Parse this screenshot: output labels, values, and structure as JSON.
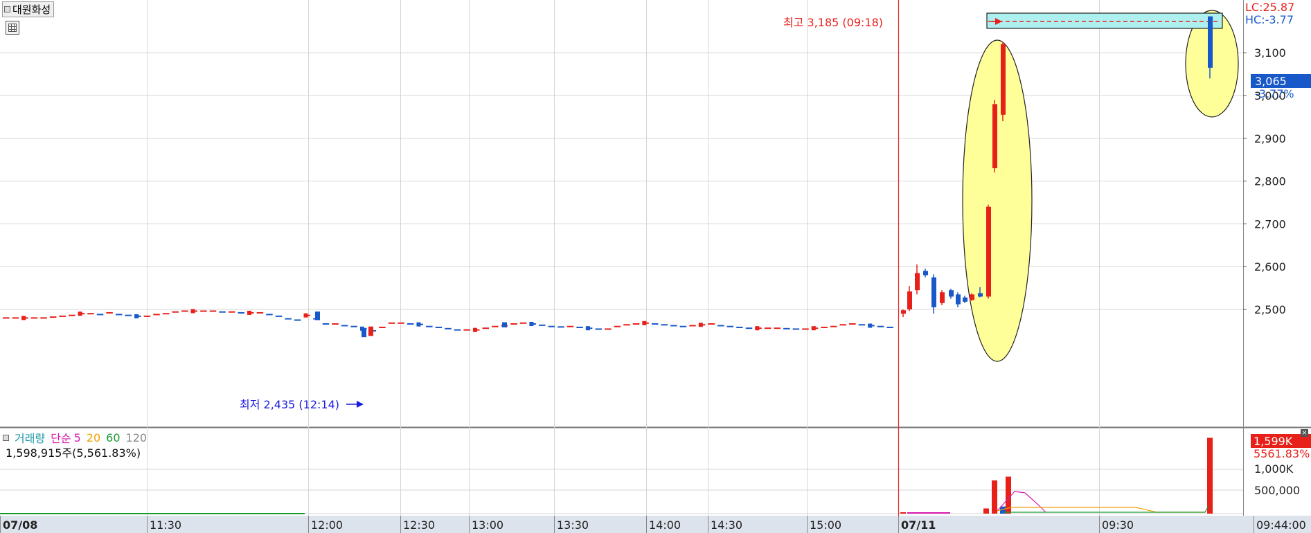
{
  "stock_name": "대원화성",
  "icons": {
    "title_marker": "square-icon",
    "grid_button": "grid-icon",
    "close": "close-icon"
  },
  "colors": {
    "up": "#e8201a",
    "down": "#1858c8",
    "grid": "#d6d6d6",
    "highlight": "#ffff9a",
    "box": "#aef0f0",
    "price_tag": "#1858c8",
    "volume_tag": "#e8201a"
  },
  "top_right": {
    "lc": "LC:25.87",
    "hc": "HC:-3.77"
  },
  "current": {
    "price": "3,065",
    "change": "-3.77%"
  },
  "annotations": {
    "high": "최고 3,185 (09:18)",
    "low": "최저 2,435 (12:14)"
  },
  "volume_panel": {
    "legend": [
      "거래량",
      "단순",
      "5",
      "20",
      "60",
      "120"
    ],
    "info": "1,598,915주(5,561.83%)",
    "tag_value": "1,599K",
    "tag_pct": "5561.83%",
    "ticks": [
      "1,000K",
      "500,000"
    ]
  },
  "x_axis": [
    "07/08",
    "11:30",
    "12:00",
    "12:30",
    "13:00",
    "13:30",
    "14:00",
    "14:30",
    "15:00",
    "07/11",
    "09:30",
    "09:44:00"
  ],
  "chart_data": {
    "type": "candlestick",
    "y_ticks": [
      3100,
      3000,
      2900,
      2800,
      2700,
      2600,
      2500
    ],
    "ylim": [
      2410,
      3200
    ],
    "day1_flat": [
      2480,
      2480,
      2480,
      2480,
      2480,
      2482,
      2484,
      2486,
      2490,
      2490,
      2488,
      2492,
      2488,
      2486,
      2484,
      2484,
      2488,
      2490,
      2494,
      2496,
      2496,
      2496,
      2496,
      2494,
      2494,
      2492,
      2492,
      2492,
      2488,
      2484,
      2478,
      2475,
      2486,
      2478,
      2466,
      2466,
      2462,
      2460,
      2455,
      2450,
      2458,
      2468,
      2468,
      2466,
      2465,
      2460,
      2458,
      2455,
      2452,
      2452,
      2452,
      2456,
      2460,
      2462,
      2466,
      2468,
      2466,
      2463,
      2460,
      2459,
      2460,
      2458,
      2456,
      2454,
      2454,
      2460,
      2464,
      2466,
      2468,
      2466,
      2464,
      2462,
      2460,
      2462,
      2464,
      2466,
      2462,
      2460,
      2458,
      2456,
      2456,
      2456,
      2456,
      2455,
      2454,
      2454,
      2456,
      2458,
      2460,
      2464,
      2466,
      2464,
      2462,
      2460,
      2458
    ],
    "day2_candles": [
      {
        "o": 2490,
        "h": 2500,
        "l": 2482,
        "c": 2498
      },
      {
        "o": 2500,
        "h": 2555,
        "l": 2496,
        "c": 2542
      },
      {
        "o": 2545,
        "h": 2605,
        "l": 2535,
        "c": 2585
      },
      {
        "o": 2590,
        "h": 2595,
        "l": 2575,
        "c": 2580
      },
      {
        "o": 2575,
        "h": 2582,
        "l": 2490,
        "c": 2505
      },
      {
        "o": 2515,
        "h": 2545,
        "l": 2510,
        "c": 2540
      },
      {
        "o": 2545,
        "h": 2548,
        "l": 2525,
        "c": 2530
      },
      {
        "o": 2535,
        "h": 2540,
        "l": 2505,
        "c": 2512
      },
      {
        "o": 2528,
        "h": 2532,
        "l": 2515,
        "c": 2518
      },
      {
        "o": 2522,
        "h": 2538,
        "l": 2520,
        "c": 2535
      },
      {
        "o": 2538,
        "h": 2552,
        "l": 2528,
        "c": 2530
      },
      {
        "o": 2530,
        "h": 2745,
        "l": 2525,
        "c": 2740
      },
      {
        "o": 2830,
        "h": 2990,
        "l": 2820,
        "c": 2980
      },
      {
        "o": 2955,
        "h": 3125,
        "l": 2940,
        "c": 3120
      },
      {
        "o": 3185,
        "h": 3185,
        "l": 3040,
        "c": 3065
      }
    ],
    "volume_day2": [
      30000,
      20000,
      110000,
      700000,
      150000,
      780000,
      1598915
    ]
  }
}
